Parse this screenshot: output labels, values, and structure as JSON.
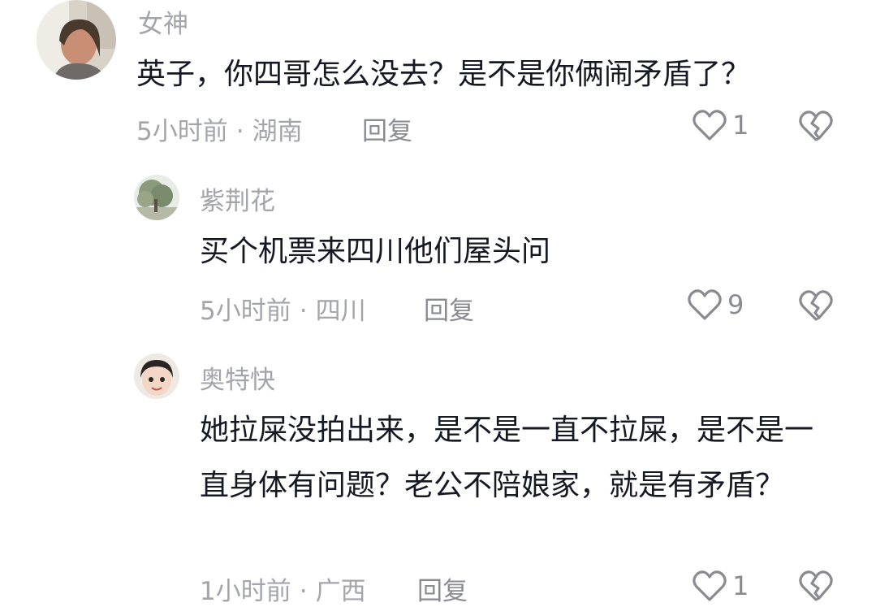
{
  "comments": [
    {
      "username": "女神",
      "text": "英子，你四哥怎么没去？是不是你俩闹矛盾了？",
      "time": "5小时前",
      "location": "湖南",
      "reply_label": "回复",
      "likes": "1"
    },
    {
      "username": "紫荆花",
      "text": "买个机票来四川他们屋头问",
      "time": "5小时前",
      "location": "四川",
      "reply_label": "回复",
      "likes": "9"
    },
    {
      "username": "奥特快",
      "text": "她拉屎没拍出来，是不是一直不拉屎，是不是一直身体有问题？老公不陪娘家，就是有矛盾？",
      "time": "1小时前",
      "location": "广西",
      "reply_label": "回复",
      "likes": "1"
    }
  ],
  "separator": "·",
  "icons": {
    "like": "heart-outline-icon",
    "dislike": "broken-heart-icon"
  },
  "colors": {
    "text": "#161823",
    "meta": "#a4a5aa",
    "background": "#ffffff"
  }
}
